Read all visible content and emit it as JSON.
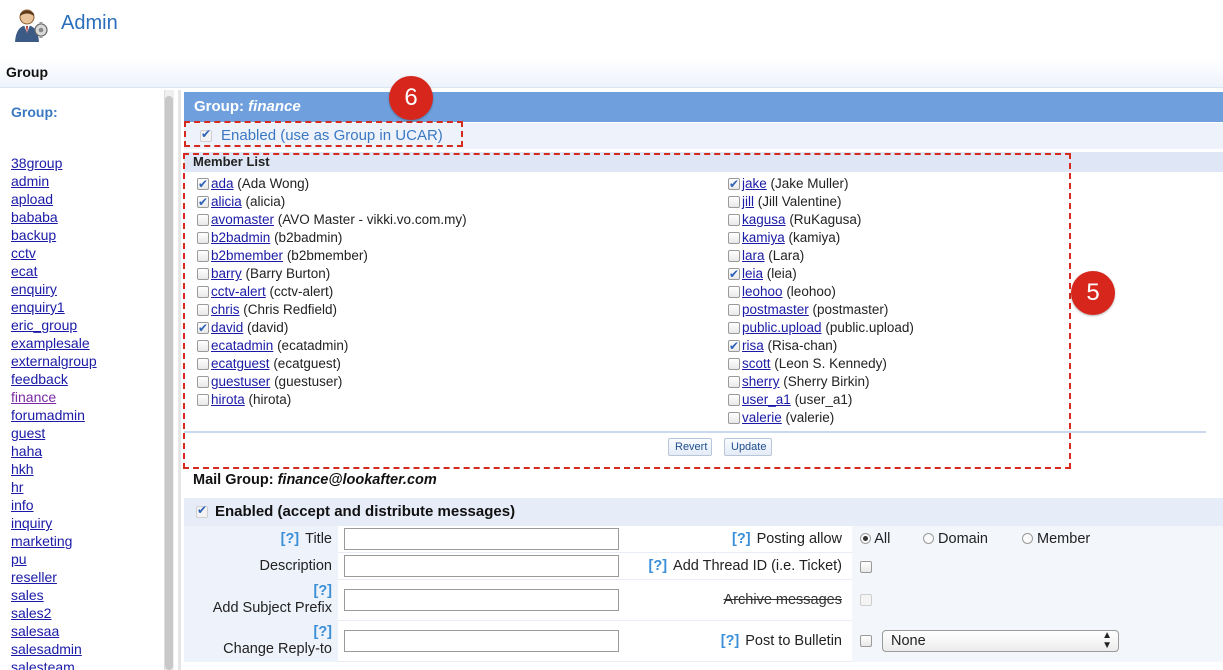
{
  "app": {
    "title": "Admin"
  },
  "breadcrumb": {
    "title": "Group"
  },
  "sidebar": {
    "heading": "Group:",
    "groups": [
      "38group",
      "admin",
      "apload",
      "bababa",
      "backup",
      "cctv",
      "ecat",
      "enquiry",
      "enquiry1",
      "eric_group",
      "examplesale",
      "externalgroup",
      "feedback",
      "finance",
      "forumadmin",
      "guest",
      "haha",
      "hkh",
      "hr",
      "info",
      "inquiry",
      "marketing",
      "pu",
      "reseller",
      "sales",
      "sales2",
      "salesaa",
      "salesadmin",
      "salesteam"
    ],
    "active": "finance"
  },
  "group": {
    "header_prefix": "Group:",
    "name": "finance",
    "enabled_label": "Enabled (use as Group in UCAR)",
    "enabled": true
  },
  "member_list": {
    "title": "Member List",
    "left": [
      {
        "user": "ada",
        "name": "(Ada Wong)",
        "checked": true
      },
      {
        "user": "alicia",
        "name": "(alicia)",
        "checked": true
      },
      {
        "user": "avomaster",
        "name": "(AVO Master - vikki.vo.com.my)",
        "checked": false
      },
      {
        "user": "b2badmin",
        "name": "(b2badmin)",
        "checked": false
      },
      {
        "user": "b2bmember",
        "name": "(b2bmember)",
        "checked": false
      },
      {
        "user": "barry",
        "name": "(Barry Burton)",
        "checked": false
      },
      {
        "user": "cctv-alert",
        "name": "(cctv-alert)",
        "checked": false
      },
      {
        "user": "chris",
        "name": "(Chris Redfield)",
        "checked": false
      },
      {
        "user": "david",
        "name": "(david)",
        "checked": true
      },
      {
        "user": "ecatadmin",
        "name": "(ecatadmin)",
        "checked": false
      },
      {
        "user": "ecatguest",
        "name": "(ecatguest)",
        "checked": false
      },
      {
        "user": "guestuser",
        "name": "(guestuser)",
        "checked": false
      },
      {
        "user": "hirota",
        "name": "(hirota)",
        "checked": false
      }
    ],
    "right": [
      {
        "user": "jake",
        "name": "(Jake Muller)",
        "checked": true
      },
      {
        "user": "jill",
        "name": "(Jill Valentine)",
        "checked": false
      },
      {
        "user": "kagusa",
        "name": "(RuKagusa)",
        "checked": false
      },
      {
        "user": "kamiya",
        "name": "(kamiya)",
        "checked": false
      },
      {
        "user": "lara",
        "name": "(Lara)",
        "checked": false
      },
      {
        "user": "leia",
        "name": "(leia)",
        "checked": true
      },
      {
        "user": "leohoo",
        "name": "(leohoo)",
        "checked": false
      },
      {
        "user": "postmaster",
        "name": "(postmaster)",
        "checked": false
      },
      {
        "user": "public.upload",
        "name": "(public.upload)",
        "checked": false
      },
      {
        "user": "risa",
        "name": "(Risa-chan)",
        "checked": true
      },
      {
        "user": "scott",
        "name": "(Leon S. Kennedy)",
        "checked": false
      },
      {
        "user": "sherry",
        "name": "(Sherry Birkin)",
        "checked": false
      },
      {
        "user": "user_a1",
        "name": "(user_a1)",
        "checked": false
      },
      {
        "user": "valerie",
        "name": "(valerie)",
        "checked": false
      }
    ],
    "revert_label": "Revert",
    "update_label": "Update"
  },
  "mail_group": {
    "title_prefix": "Mail Group:",
    "address": "finance@lookafter.com",
    "enabled_label": "Enabled (accept and distribute messages)",
    "help": "[?]",
    "title_label": "Title",
    "description_label": "Description",
    "subject_prefix_label": "Add Subject Prefix",
    "reply_to_label": "Change Reply-to",
    "posting_allow_label": "Posting allow",
    "posting_options": [
      "All",
      "Domain",
      "Member"
    ],
    "posting_selected": "All",
    "thread_id_label": "Add Thread ID (i.e. Ticket)",
    "archive_label": "Archive messages",
    "bulletin_label": "Post to Bulletin",
    "bulletin_value": "None"
  },
  "annotations": {
    "badge_group": "6",
    "badge_members": "5",
    "accent": "#d7261c"
  }
}
